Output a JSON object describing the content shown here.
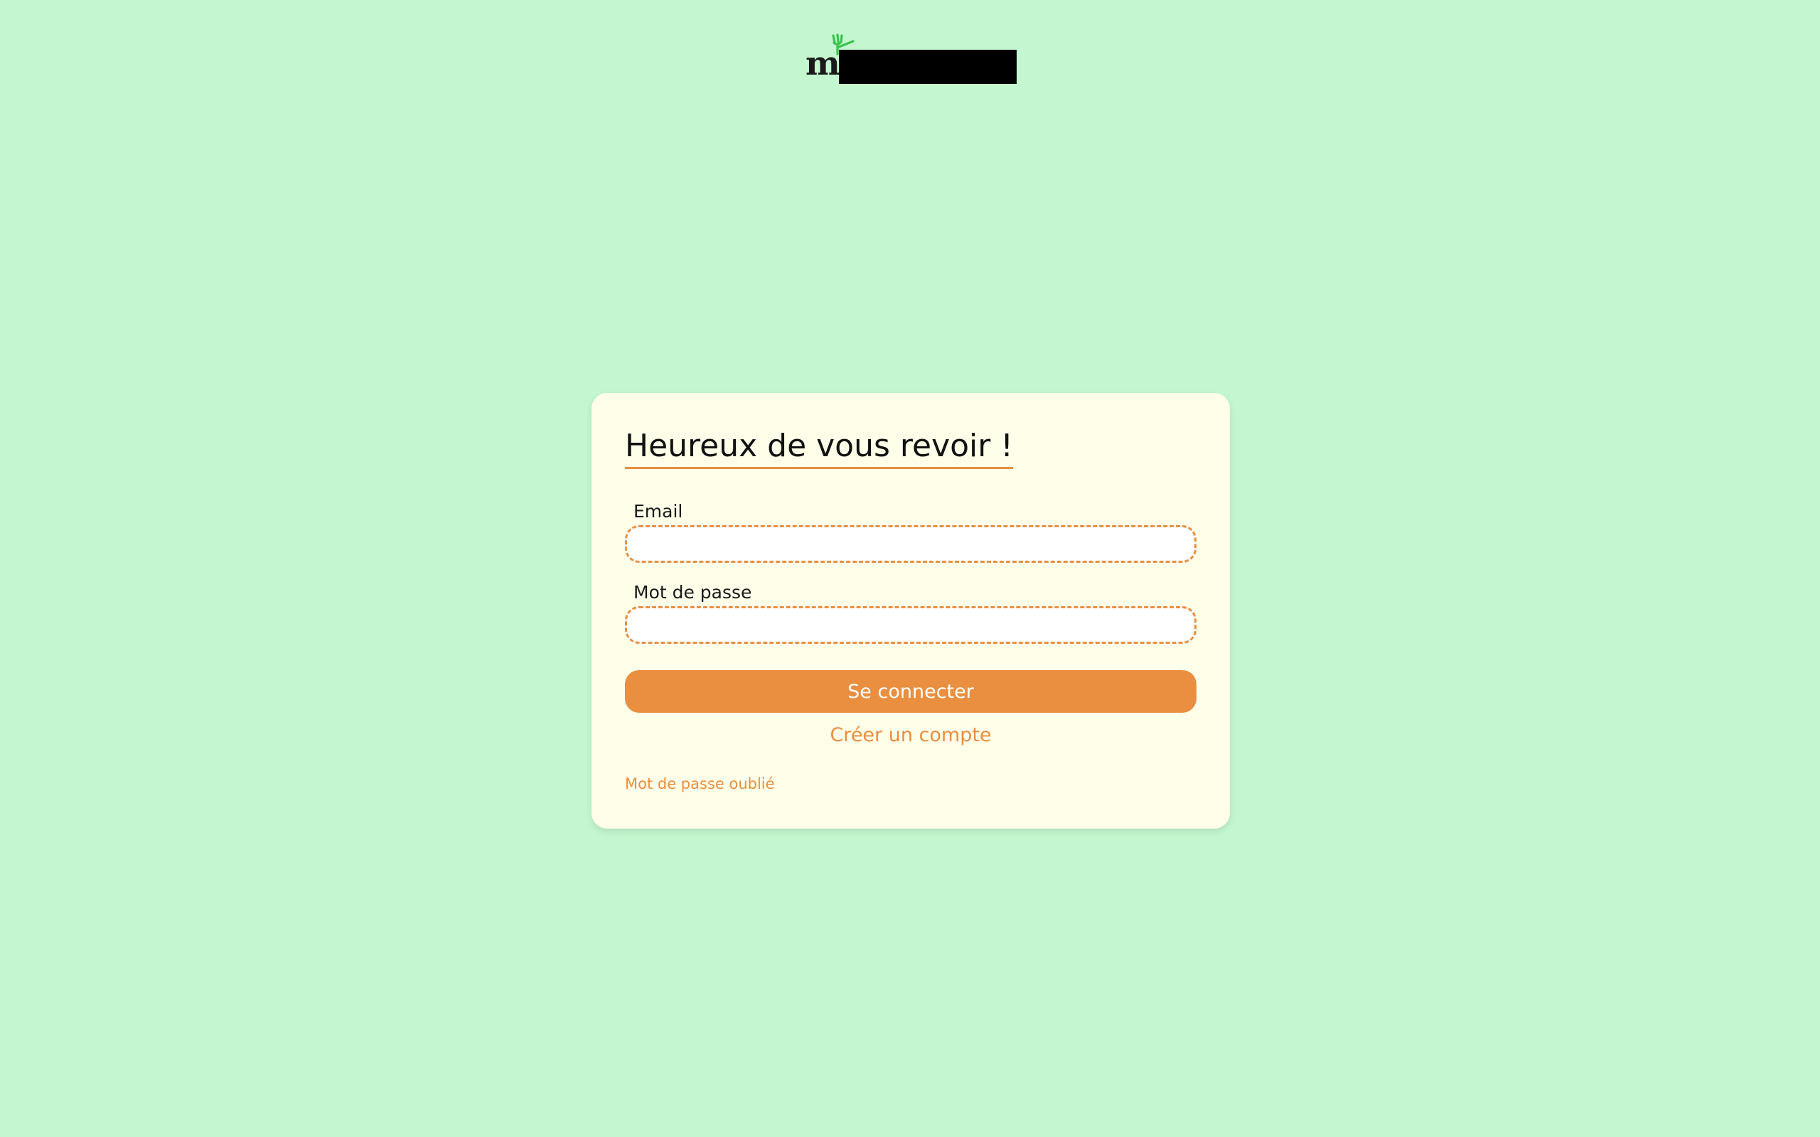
{
  "logo": {
    "letter": "m",
    "icon": "fork-icon"
  },
  "login": {
    "title": "Heureux de vous revoir !",
    "email_label": "Email",
    "email_value": "",
    "password_label": "Mot de passe",
    "password_value": "",
    "submit_label": "Se connecter",
    "create_account_label": "Créer un compte",
    "forgot_password_label": "Mot de passe oublié"
  },
  "colors": {
    "background": "#c4f7cf",
    "card": "#fffee9",
    "accent": "#e98f3f",
    "logo_leaf": "#3bc24f"
  }
}
